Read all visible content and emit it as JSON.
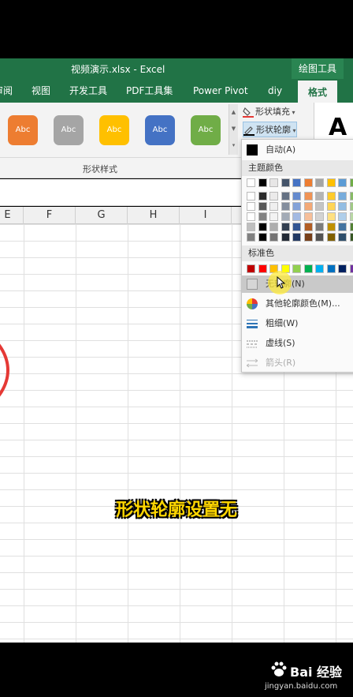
{
  "window": {
    "title": "视频演示.xlsx - Excel",
    "context_tab": "绘图工具"
  },
  "tabs": [
    {
      "label": "审阅",
      "active": false
    },
    {
      "label": "视图",
      "active": false
    },
    {
      "label": "开发工具",
      "active": false
    },
    {
      "label": "PDF工具集",
      "active": false
    },
    {
      "label": "Power Pivot",
      "active": false
    },
    {
      "label": "diy",
      "active": false
    },
    {
      "label": "格式",
      "active": true
    }
  ],
  "shape_styles": {
    "items": [
      {
        "label": "Abc",
        "color": "#ed7d31"
      },
      {
        "label": "Abc",
        "color": "#a5a5a5"
      },
      {
        "label": "Abc",
        "color": "#ffc000"
      },
      {
        "label": "Abc",
        "color": "#4472c4"
      },
      {
        "label": "Abc",
        "color": "#70ad47"
      }
    ],
    "group_label": "形状样式"
  },
  "ribbon_commands": {
    "fill": "形状填充",
    "outline": "形状轮廓"
  },
  "wordart_preview": "A",
  "columns": [
    "E",
    "F",
    "G",
    "H",
    "I"
  ],
  "outline_menu": {
    "auto": "自动(A)",
    "theme_colors_header": "主题颜色",
    "standard_colors_header": "标准色",
    "no_outline": "无轮廓(N)",
    "more_colors": "其他轮廓颜色(M)...",
    "weight": "粗细(W)",
    "dashes": "虚线(S)",
    "arrows": "箭头(R)"
  },
  "theme_colors": [
    "#ffffff",
    "#000000",
    "#e7e6e6",
    "#44546a",
    "#4472c4",
    "#ed7d31",
    "#a5a5a5",
    "#ffc000",
    "#5b9bd5",
    "#70ad47"
  ],
  "standard_colors": [
    "#c00000",
    "#ff0000",
    "#ffc000",
    "#ffff00",
    "#92d050",
    "#00b050",
    "#00b0f0",
    "#0070c0",
    "#002060",
    "#7030a0"
  ],
  "subtitle": "形状轮廓设置无",
  "watermark": {
    "brand": "Bai 经验",
    "url": "jingyan.baidu.com"
  }
}
